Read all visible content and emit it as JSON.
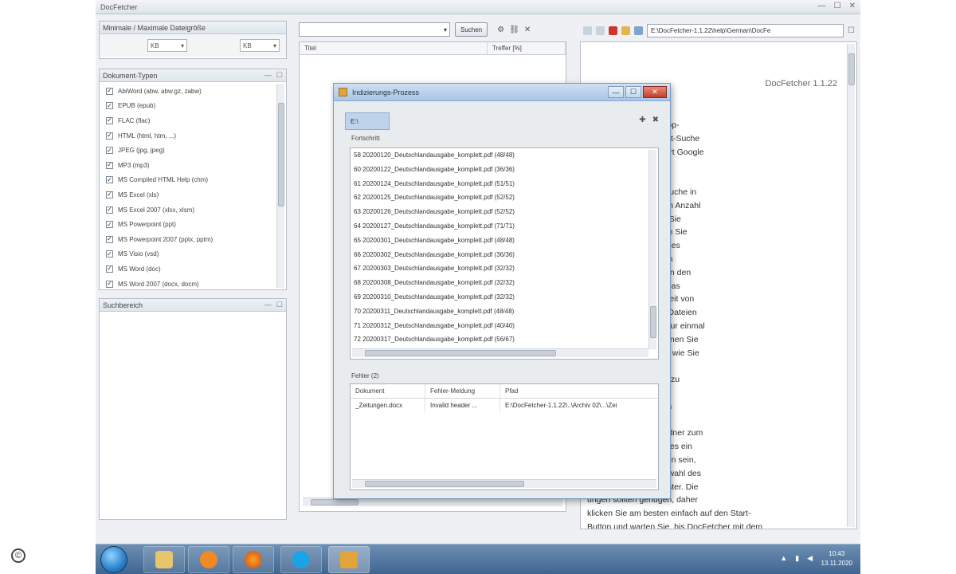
{
  "copyright_symbol": "©",
  "app": {
    "title": "DocFetcher",
    "win_min": "—",
    "win_max": "☐",
    "win_close": "✕"
  },
  "left": {
    "size_header": "Minimale / Maximale Dateigröße",
    "min_size": "KB",
    "max_size": "KB",
    "types_header": "Dokument-Typen",
    "types": [
      "AbiWord (abw, abw.gz, zabw)",
      "EPUB (epub)",
      "FLAC (flac)",
      "HTML (html, htm, ...)",
      "JPEG (jpg, jpeg)",
      "MP3 (mp3)",
      "MS Compiled HTML Help (chm)",
      "MS Excel (xls)",
      "MS Excel 2007 (xlsx, xlsm)",
      "MS Powerpoint (ppt)",
      "MS Powerpoint 2007 (pptx, pptm)",
      "MS Visio (vsd)",
      "MS Word (doc)",
      "MS Word 2007 (docx, docm)"
    ],
    "searchscope_header": "Suchbereich"
  },
  "search": {
    "query": "",
    "button": "Suchen",
    "col_title": "Titel",
    "col_hits": "Treffer [%]"
  },
  "help": {
    "url": "E:\\DocFetcher-1.1.22\\help\\German\\DocFe",
    "version": "DocFetcher 1.1.22",
    "lines": [
      "n Open Source Desktop-",
      "t ermöglicht die Volltext-Suche",
      "m Computer — eine Art Google",
      "ner.",
      "",
      "uche: Da die direkte Suche in",
      "eeis bei einer größeren Anzahl",
      "ngsam wäre, müssen Sie",
      "ices erstellen, in denen Sie",
      "ense Indizes erlauben es",
      "ell Dateien anhand von",
      "finden, ähnlich wie man den",
      "nes Buches benutzt. Das",
      "des mag in Abhängigkeit von",
      "Größe der indizierten Dateien",
      "n. Jedoch muss dies nur einmal",
      "ehen, und danach können Sie",
      "Ordnern so oft suchen wie Sie",
      "",
      "ndex: Um einen Index zu",
      "icken Sie auf den",
      "es und wählen Sie den",
      "n erstellen aus >",
      "hlen Sie nun einen Ordner zum",
      "ür den Anfang sollte dies ein",
      "t nicht zu vielen Dateien sein,",
      "50 Dateien. Nach Auswahl des",
      "t ein Einstellungs-Fenster. Die",
      "ungen sollten genügen, daher",
      "klicken Sie am besten einfach auf den Start-",
      "Button und warten Sie, bis DocFetcher mit dem",
      "Indizieren fertig ist. (Eine weitere Möglichkeit"
    ]
  },
  "dialog": {
    "title": "Indizierungs-Prozess",
    "btn_min": "—",
    "btn_max": "☐",
    "btn_close": "✕",
    "tab": "E:\\",
    "progress_label": "Fortschritt",
    "log": [
      "58 20200120_Deutschlandausgabe_komplett.pdf (48/48)",
      "60 20200122_Deutschlandausgabe_komplett.pdf (36/36)",
      "61 20200124_Deutschlandausgabe_komplett.pdf (51/51)",
      "62 20200125_Deutschlandausgabe_komplett.pdf (52/52)",
      "63 20200126_Deutschlandausgabe_komplett.pdf (52/52)",
      "64 20200127_Deutschlandausgabe_komplett.pdf (71/71)",
      "65 20200301_Deutschlandausgabe_komplett.pdf (48/48)",
      "66 20200302_Deutschlandausgabe_komplett.pdf (36/36)",
      "67 20200303_Deutschlandausgabe_komplett.pdf (32/32)",
      "68 20200308_Deutschlandausgabe_komplett.pdf (32/32)",
      "69 20200310_Deutschlandausgabe_komplett.pdf (32/32)",
      "70 20200311_Deutschlandausgabe_komplett.pdf (48/48)",
      "71 20200312_Deutschlandausgabe_komplett.pdf (40/40)",
      "72 20200317_Deutschlandausgabe_komplett.pdf (56/67)"
    ],
    "errors_label": "Fehler (2)",
    "err_cols": [
      "Dokument",
      "Fehler-Meldung",
      "Pfad"
    ],
    "err_rows": [
      [
        "_Zeitungen.docx",
        "Invalid header ...",
        "E:\\DocFetcher-1.1.22\\..\\Archiv 02\\...\\Zei"
      ]
    ]
  },
  "taskbar": {
    "time": "10:43",
    "date": "13.11.2020"
  }
}
